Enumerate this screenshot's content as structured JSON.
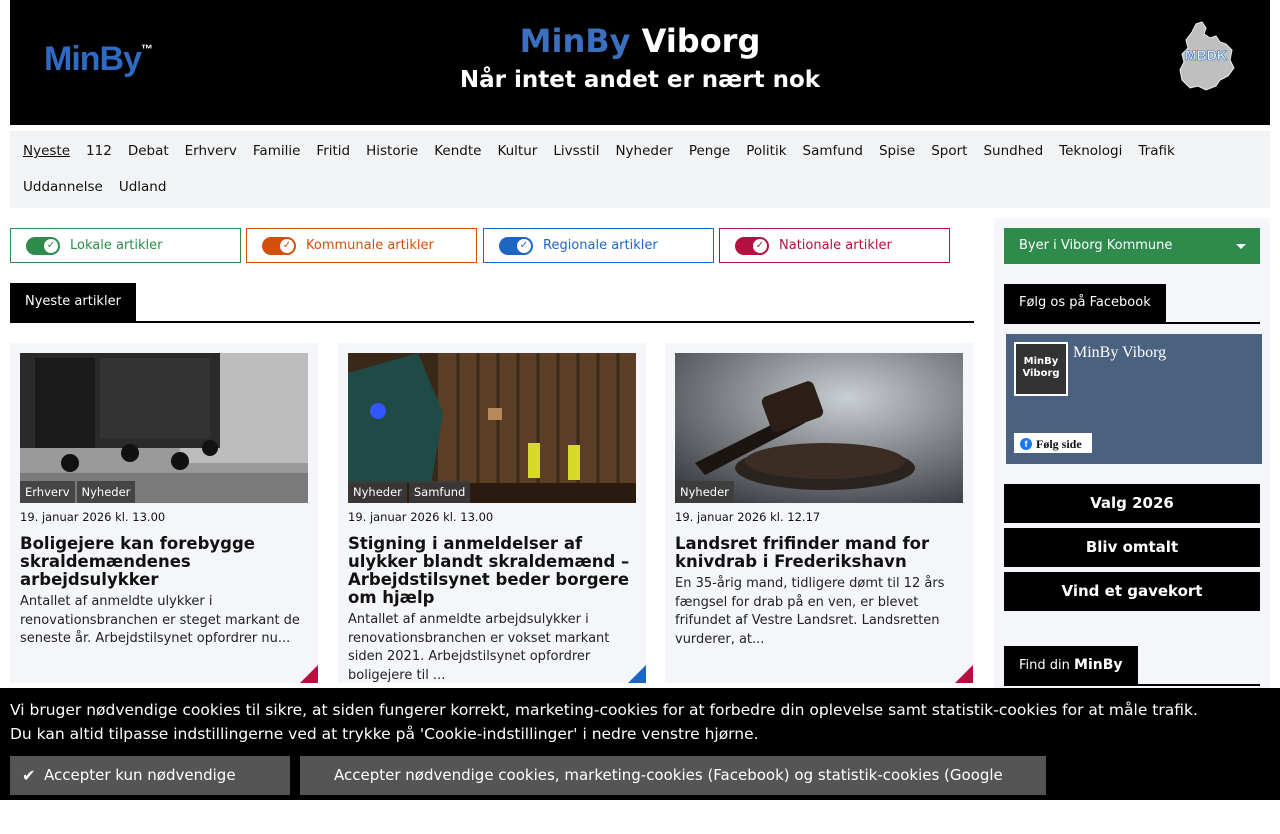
{
  "header": {
    "logo_min": "MinBy",
    "logo_by": "",
    "logo_tm": "™",
    "title_brand": "MinBy",
    "title_city": "Viborg",
    "tagline": "Når intet andet er nært nok",
    "mbdk_label": "MBDK"
  },
  "nav": {
    "items": [
      "Nyeste",
      "112",
      "Debat",
      "Erhverv",
      "Familie",
      "Fritid",
      "Historie",
      "Kendte",
      "Kultur",
      "Livsstil",
      "Nyheder",
      "Penge",
      "Politik",
      "Samfund",
      "Spise",
      "Sport",
      "Sundhed",
      "Teknologi",
      "Trafik",
      "Uddannelse",
      "Udland"
    ]
  },
  "filters": {
    "local": "Lokale artikler",
    "municipal": "Kommunale artikler",
    "regional": "Regionale artikler",
    "national": "Nationale artikler"
  },
  "section": {
    "tab_label": "Nyeste artikler"
  },
  "articles": [
    {
      "tags": [
        "Erhverv",
        "Nyheder"
      ],
      "date": "19. januar 2026 kl. 13.00",
      "title": "Boligejere kan forebygge skraldemændenes arbejdsulykker",
      "excerpt": "Antallet af anmeldte ulykker i renovationsbranchen er steget markant de seneste år. Arbejdstilsynet opfordrer nu...",
      "corner_color": "#b5103f"
    },
    {
      "tags": [
        "Nyheder",
        "Samfund"
      ],
      "date": "19. januar 2026 kl. 13.00",
      "title": "Stigning i anmeldelser af ulykker blandt skraldemænd – Arbejdstilsynet beder borgere om hjælp",
      "excerpt": "Antallet af anmeldte arbejdsulykker i renovationsbranchen er vokset markant siden 2021. Arbejdstilsynet opfordrer boligejere til ...",
      "corner_color": "#1e66c4"
    },
    {
      "tags": [
        "Nyheder"
      ],
      "date": "19. januar 2026 kl. 12.17",
      "title": "Landsret frifinder mand for knivdrab i Frederikshavn",
      "excerpt": "En 35-årig mand, tidligere dømt til 12 års fængsel for drab på en ven, er blevet frifundet af Vestre Landsret. Landsretten vurderer, at...",
      "corner_color": "#b5103f"
    }
  ],
  "sidebar": {
    "dropdown_label": "Byer i Viborg Kommune",
    "facebook_tab": "Følg os på Facebook",
    "fb_page_name": "MinBy Viborg",
    "fb_logo_line1": "MinBy",
    "fb_logo_line2": "Viborg",
    "fb_follow": "Følg side",
    "buttons": [
      "Valg 2026",
      "Bliv omtalt",
      "Vind et gavekort"
    ],
    "find_prefix": "Find din ",
    "find_brand": "MinBy"
  },
  "cookie": {
    "line1": "Vi bruger nødvendige cookies til sikre, at siden fungerer korrekt, marketing-cookies for at forbedre din oplevelse samt statistik-cookies for at måle trafik.",
    "line2": "Du kan altid tilpasse indstillingerne ved at trykke på 'Cookie-indstillinger' i nedre venstre hjørne.",
    "btn_necessary": "Accepter kun nødvendige cookies",
    "btn_all": "Accepter nødvendige cookies, marketing-cookies (Facebook) og statistik-cookies (Google Analytics)"
  },
  "colors": {
    "local": "#2e8b4b",
    "municipal": "#d34f0b",
    "regional": "#1e66c4",
    "national": "#b5103f"
  }
}
